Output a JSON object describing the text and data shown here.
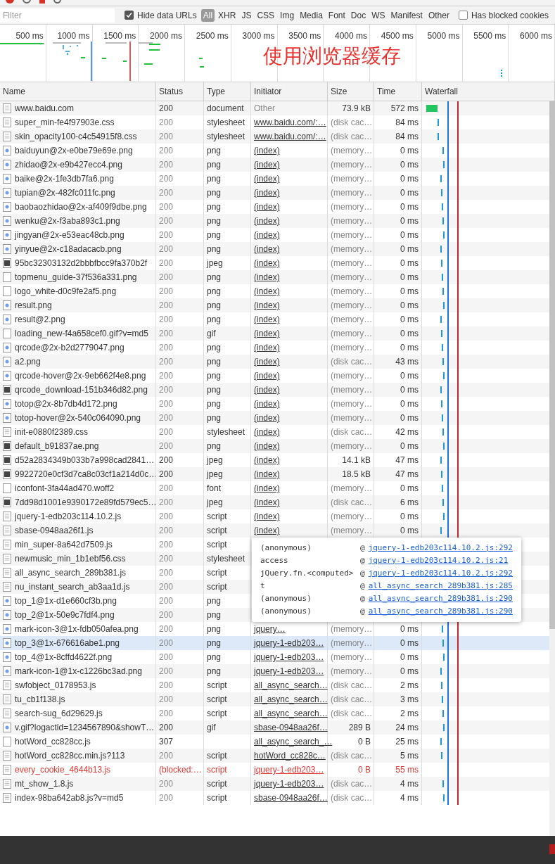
{
  "filter_bar": {
    "placeholder": "Filter",
    "hide_data_urls": {
      "label": "Hide data URLs",
      "checked": true
    },
    "types": [
      {
        "label": "All",
        "selected": true
      },
      {
        "label": "XHR",
        "selected": false
      },
      {
        "label": "JS",
        "selected": false
      },
      {
        "label": "CSS",
        "selected": false
      },
      {
        "label": "Img",
        "selected": false
      },
      {
        "label": "Media",
        "selected": false
      },
      {
        "label": "Font",
        "selected": false
      },
      {
        "label": "Doc",
        "selected": false
      },
      {
        "label": "WS",
        "selected": false
      },
      {
        "label": "Manifest",
        "selected": false
      },
      {
        "label": "Other",
        "selected": false
      }
    ],
    "blocked_cookies": {
      "label": "Has blocked cookies",
      "checked": false
    }
  },
  "overview": {
    "ticks": [
      "500 ms",
      "1000 ms",
      "1500 ms",
      "2000 ms",
      "2500 ms",
      "3000 ms",
      "3500 ms",
      "4000 ms",
      "4500 ms",
      "5000 ms",
      "5500 ms",
      "6000 ms"
    ],
    "annotation": "使用浏览器缓存"
  },
  "table": {
    "columns": [
      "Name",
      "Status",
      "Type",
      "Initiator",
      "Size",
      "Time",
      "Waterfall"
    ],
    "rows": [
      {
        "kind": "doc",
        "name": "www.baidu.com",
        "status": "200",
        "type": "document",
        "initiator": "Other",
        "initiator_link": false,
        "size": "73.9 kB",
        "time": "572 ms",
        "cached": false
      },
      {
        "kind": "doc",
        "name": "super_min-fe4f97903e.css",
        "status": "200",
        "type": "stylesheet",
        "initiator": "www.baidu.com/:…",
        "size": "(disk cac…",
        "time": "84 ms",
        "cached": true
      },
      {
        "kind": "doc",
        "name": "skin_opacity100-c4c54915f8.css",
        "status": "200",
        "type": "stylesheet",
        "initiator": "www.baidu.com/:…",
        "size": "(disk cac…",
        "time": "84 ms",
        "cached": true
      },
      {
        "kind": "image",
        "name": "baiduyun@2x-e0be79e69e.png",
        "status": "200",
        "type": "png",
        "initiator": "(index)",
        "size": "(memory…",
        "time": "0 ms",
        "cached": true
      },
      {
        "kind": "image",
        "name": "zhidao@2x-e9b427ecc4.png",
        "status": "200",
        "type": "png",
        "initiator": "(index)",
        "size": "(memory…",
        "time": "0 ms",
        "cached": true
      },
      {
        "kind": "image",
        "name": "baike@2x-1fe3db7fa6.png",
        "status": "200",
        "type": "png",
        "initiator": "(index)",
        "size": "(memory…",
        "time": "0 ms",
        "cached": true
      },
      {
        "kind": "image",
        "name": "tupian@2x-482fc011fc.png",
        "status": "200",
        "type": "png",
        "initiator": "(index)",
        "size": "(memory…",
        "time": "0 ms",
        "cached": true
      },
      {
        "kind": "image",
        "name": "baobaozhidao@2x-af409f9dbe.png",
        "status": "200",
        "type": "png",
        "initiator": "(index)",
        "size": "(memory…",
        "time": "0 ms",
        "cached": true
      },
      {
        "kind": "image",
        "name": "wenku@2x-f3aba893c1.png",
        "status": "200",
        "type": "png",
        "initiator": "(index)",
        "size": "(memory…",
        "time": "0 ms",
        "cached": true
      },
      {
        "kind": "image",
        "name": "jingyan@2x-e53eac48cb.png",
        "status": "200",
        "type": "png",
        "initiator": "(index)",
        "size": "(memory…",
        "time": "0 ms",
        "cached": true
      },
      {
        "kind": "image",
        "name": "yinyue@2x-c18adacacb.png",
        "status": "200",
        "type": "png",
        "initiator": "(index)",
        "size": "(memory…",
        "time": "0 ms",
        "cached": true
      },
      {
        "kind": "photo",
        "name": "95bc32303132d2bbbfbcc9fa370b2f",
        "status": "200",
        "type": "jpeg",
        "initiator": "(index)",
        "size": "(memory…",
        "time": "0 ms",
        "cached": true
      },
      {
        "kind": "blank",
        "name": "topmenu_guide-37f536a331.png",
        "status": "200",
        "type": "png",
        "initiator": "(index)",
        "size": "(memory…",
        "time": "0 ms",
        "cached": true
      },
      {
        "kind": "blank",
        "name": "logo_white-d0c9fe2af5.png",
        "status": "200",
        "type": "png",
        "initiator": "(index)",
        "size": "(memory…",
        "time": "0 ms",
        "cached": true
      },
      {
        "kind": "image",
        "name": "result.png",
        "status": "200",
        "type": "png",
        "initiator": "(index)",
        "size": "(memory…",
        "time": "0 ms",
        "cached": true
      },
      {
        "kind": "image",
        "name": "result@2.png",
        "status": "200",
        "type": "png",
        "initiator": "(index)",
        "size": "(memory…",
        "time": "0 ms",
        "cached": true
      },
      {
        "kind": "blank",
        "name": "loading_new-f4a658cef0.gif?v=md5",
        "status": "200",
        "type": "gif",
        "initiator": "(index)",
        "size": "(memory…",
        "time": "0 ms",
        "cached": true
      },
      {
        "kind": "image",
        "name": "qrcode@2x-b2d2779047.png",
        "status": "200",
        "type": "png",
        "initiator": "(index)",
        "size": "(memory…",
        "time": "0 ms",
        "cached": true
      },
      {
        "kind": "image",
        "name": "a2.png",
        "status": "200",
        "type": "png",
        "initiator": "(index)",
        "size": "(disk cac…",
        "time": "43 ms",
        "cached": true
      },
      {
        "kind": "image",
        "name": "qrcode-hover@2x-9eb662f4e8.png",
        "status": "200",
        "type": "png",
        "initiator": "(index)",
        "size": "(memory…",
        "time": "0 ms",
        "cached": true
      },
      {
        "kind": "photo",
        "name": "qrcode_download-151b346d82.png",
        "status": "200",
        "type": "png",
        "initiator": "(index)",
        "size": "(memory…",
        "time": "0 ms",
        "cached": true
      },
      {
        "kind": "image",
        "name": "totop@2x-8b7db4d172.png",
        "status": "200",
        "type": "png",
        "initiator": "(index)",
        "size": "(memory…",
        "time": "0 ms",
        "cached": true
      },
      {
        "kind": "image",
        "name": "totop-hover@2x-540c064090.png",
        "status": "200",
        "type": "png",
        "initiator": "(index)",
        "size": "(memory…",
        "time": "0 ms",
        "cached": true
      },
      {
        "kind": "doc",
        "name": "init-e0880f2389.css",
        "status": "200",
        "type": "stylesheet",
        "initiator": "(index)",
        "size": "(disk cac…",
        "time": "42 ms",
        "cached": true
      },
      {
        "kind": "photo",
        "name": "default_b91837ae.png",
        "status": "200",
        "type": "png",
        "initiator": "(index)",
        "size": "(memory…",
        "time": "0 ms",
        "cached": true
      },
      {
        "kind": "photo",
        "name": "d52a2834349b033b7a998cad2841…",
        "status": "200",
        "type": "jpeg",
        "initiator": "(index)",
        "size": "14.1 kB",
        "time": "47 ms",
        "cached": false
      },
      {
        "kind": "photo",
        "name": "9922720e0cf3d7ca8c03cf1a214d0c…",
        "status": "200",
        "type": "jpeg",
        "initiator": "(index)",
        "size": "18.5 kB",
        "time": "47 ms",
        "cached": false
      },
      {
        "kind": "blank",
        "name": "iconfont-3fa44ad470.woff2",
        "status": "200",
        "type": "font",
        "initiator": "(index)",
        "size": "(memory…",
        "time": "0 ms",
        "cached": true
      },
      {
        "kind": "photo",
        "name": "7dd98d1001e9390172e89fd579ec5…",
        "status": "200",
        "type": "jpeg",
        "initiator": "(index)",
        "size": "(disk cac…",
        "time": "6 ms",
        "cached": true
      },
      {
        "kind": "doc",
        "name": "jquery-1-edb203c114.10.2.js",
        "status": "200",
        "type": "script",
        "initiator": "(index)",
        "size": "(memory…",
        "time": "0 ms",
        "cached": true
      },
      {
        "kind": "doc",
        "name": "sbase-0948aa26f1.js",
        "status": "200",
        "type": "script",
        "initiator": "(index)",
        "size": "(memory…",
        "time": "0 ms",
        "cached": true
      },
      {
        "kind": "doc",
        "name": "min_super-8a642d7509.js",
        "status": "200",
        "type": "script",
        "cached": true
      },
      {
        "kind": "doc",
        "name": "newmusic_min_1b1ebf56.css",
        "status": "200",
        "type": "stylesheet",
        "cached": true
      },
      {
        "kind": "doc",
        "name": "all_async_search_289b381.js",
        "status": "200",
        "type": "script",
        "cached": true
      },
      {
        "kind": "doc",
        "name": "nu_instant_search_ab3aa1d.js",
        "status": "200",
        "type": "script",
        "cached": true
      },
      {
        "kind": "image",
        "name": "top_1@1x-d1e660cf3b.png",
        "status": "200",
        "type": "png",
        "cached": true
      },
      {
        "kind": "image",
        "name": "top_2@1x-50e9c7fdf4.png",
        "status": "200",
        "type": "png",
        "cached": true
      },
      {
        "kind": "image",
        "name": "mark-icon-3@1x-fdb050afea.png",
        "status": "200",
        "type": "png",
        "initiator": "jquery…",
        "size": "(memory…",
        "time": "0 ms",
        "cached": true
      },
      {
        "kind": "image",
        "name": "top_3@1x-676616abe1.png",
        "status": "200",
        "type": "png",
        "initiator": "jquery-1-edb203…",
        "size": "(memory…",
        "time": "0 ms",
        "cached": true,
        "hovered": true
      },
      {
        "kind": "image",
        "name": "top_4@1x-8cffd4622f.png",
        "status": "200",
        "type": "png",
        "initiator": "jquery-1-edb203…",
        "size": "(memory…",
        "time": "0 ms",
        "cached": true
      },
      {
        "kind": "image",
        "name": "mark-icon-1@1x-c1226bc3ad.png",
        "status": "200",
        "type": "png",
        "initiator": "jquery-1-edb203…",
        "size": "(memory…",
        "time": "0 ms",
        "cached": true
      },
      {
        "kind": "doc",
        "name": "swfobject_0178953.js",
        "status": "200",
        "type": "script",
        "initiator": "all_async_search…",
        "size": "(disk cac…",
        "time": "2 ms",
        "cached": true
      },
      {
        "kind": "doc",
        "name": "tu_cb1f138.js",
        "status": "200",
        "type": "script",
        "initiator": "all_async_search…",
        "size": "(disk cac…",
        "time": "3 ms",
        "cached": true
      },
      {
        "kind": "doc",
        "name": "search-sug_6d29629.js",
        "status": "200",
        "type": "script",
        "initiator": "all_async_search…",
        "size": "(disk cac…",
        "time": "2 ms",
        "cached": true
      },
      {
        "kind": "image",
        "name": "v.gif?logactid=1234567890&showT…",
        "status": "200",
        "type": "gif",
        "initiator": "sbase-0948aa26f…",
        "size": "289 B",
        "time": "24 ms",
        "cached": false
      },
      {
        "kind": "blank",
        "name": "hotWord_cc828cc.js",
        "status": "307",
        "initiator": "all_async_search_…",
        "size": "0 B",
        "time": "25 ms",
        "cached": false
      },
      {
        "kind": "doc",
        "name": "hotWord_cc828cc.min.js?113",
        "status": "200",
        "type": "script",
        "initiator": "hotWord_cc828c…",
        "size": "(disk cac…",
        "time": "5 ms",
        "cached": true
      },
      {
        "kind": "doc",
        "name": "every_cookie_4644b13.js",
        "status": "(blocked:…",
        "type": "script",
        "initiator": "jquery-1-edb203…",
        "size": "0 B",
        "time": "55 ms",
        "blocked": true
      },
      {
        "kind": "doc",
        "name": "mt_show_1.8.js",
        "status": "200",
        "type": "script",
        "initiator": "jquery-1-edb203…",
        "size": "(disk cac…",
        "time": "4 ms",
        "cached": true
      },
      {
        "kind": "doc",
        "name": "index-98ba642ab8.js?v=md5",
        "status": "200",
        "type": "script",
        "initiator": "sbase-0948aa26f…",
        "size": "(disk cac…",
        "time": "4 ms",
        "cached": true
      }
    ]
  },
  "stack_tooltip": {
    "frames": [
      {
        "function": "(anonymous)",
        "at": "@",
        "location": "jquery-1-edb203c114.10.2.js:292"
      },
      {
        "function": "access",
        "at": "@",
        "location": "jquery-1-edb203c114.10.2.js:21"
      },
      {
        "function": "jQuery.fn.<computed>",
        "at": "@",
        "location": "jquery-1-edb203c114.10.2.js:292"
      },
      {
        "function": "t",
        "at": "@",
        "location": "all_async_search_289b381.js:285"
      },
      {
        "function": "(anonymous)",
        "at": "@",
        "location": "all_async_search_289b381.js:290"
      },
      {
        "function": "(anonymous)",
        "at": "@",
        "location": "all_async_search_289b381.js:290"
      }
    ]
  }
}
